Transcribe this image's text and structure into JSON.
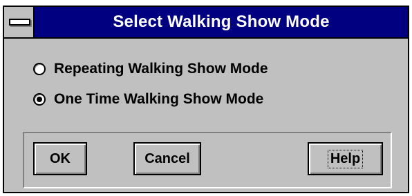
{
  "dialog": {
    "title": "Select Walking Show Mode",
    "options": [
      {
        "label": "Repeating Walking Show Mode",
        "selected": false
      },
      {
        "label": "One Time Walking Show Mode",
        "selected": true
      }
    ],
    "buttons": {
      "ok": "OK",
      "cancel": "Cancel",
      "help": "Help"
    }
  },
  "icons": {
    "system_menu": "system-menu-icon"
  },
  "colors": {
    "titlebar": "#000080",
    "face": "#c0c0c0"
  }
}
